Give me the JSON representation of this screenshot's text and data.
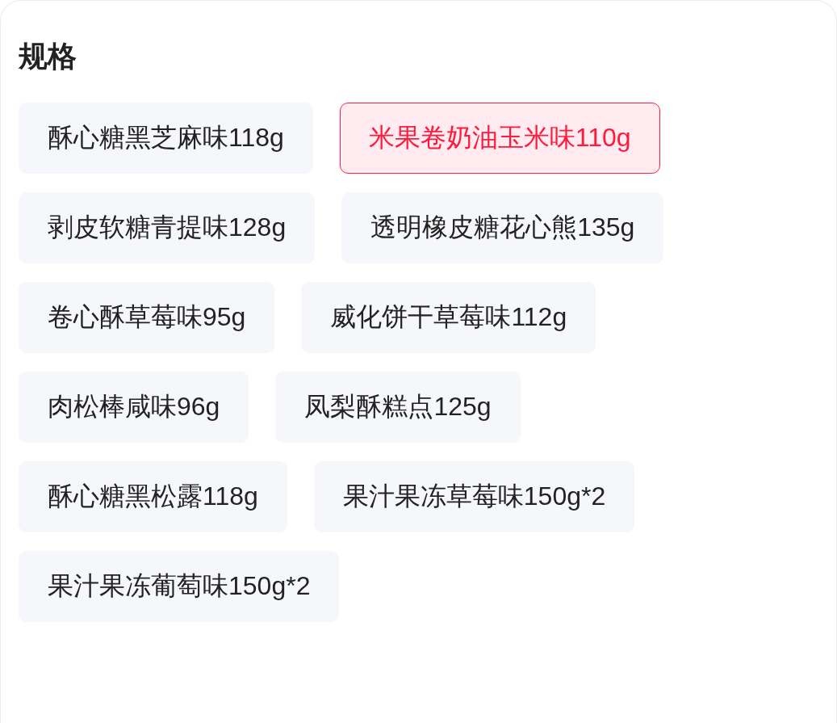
{
  "specs": {
    "title": "规格",
    "options": [
      {
        "label": "酥心糖黑芝麻味118g",
        "selected": false
      },
      {
        "label": "米果卷奶油玉米味110g",
        "selected": true
      },
      {
        "label": "剥皮软糖青提味128g",
        "selected": false
      },
      {
        "label": "透明橡皮糖花心熊135g",
        "selected": false
      },
      {
        "label": "卷心酥草莓味95g",
        "selected": false
      },
      {
        "label": "威化饼干草莓味112g",
        "selected": false
      },
      {
        "label": "肉松棒咸味96g",
        "selected": false
      },
      {
        "label": "凤梨酥糕点125g",
        "selected": false
      },
      {
        "label": "酥心糖黑松露118g",
        "selected": false
      },
      {
        "label": "果汁果冻草莓味150g*2",
        "selected": false
      },
      {
        "label": "果汁果冻葡萄味150g*2",
        "selected": false
      }
    ]
  }
}
